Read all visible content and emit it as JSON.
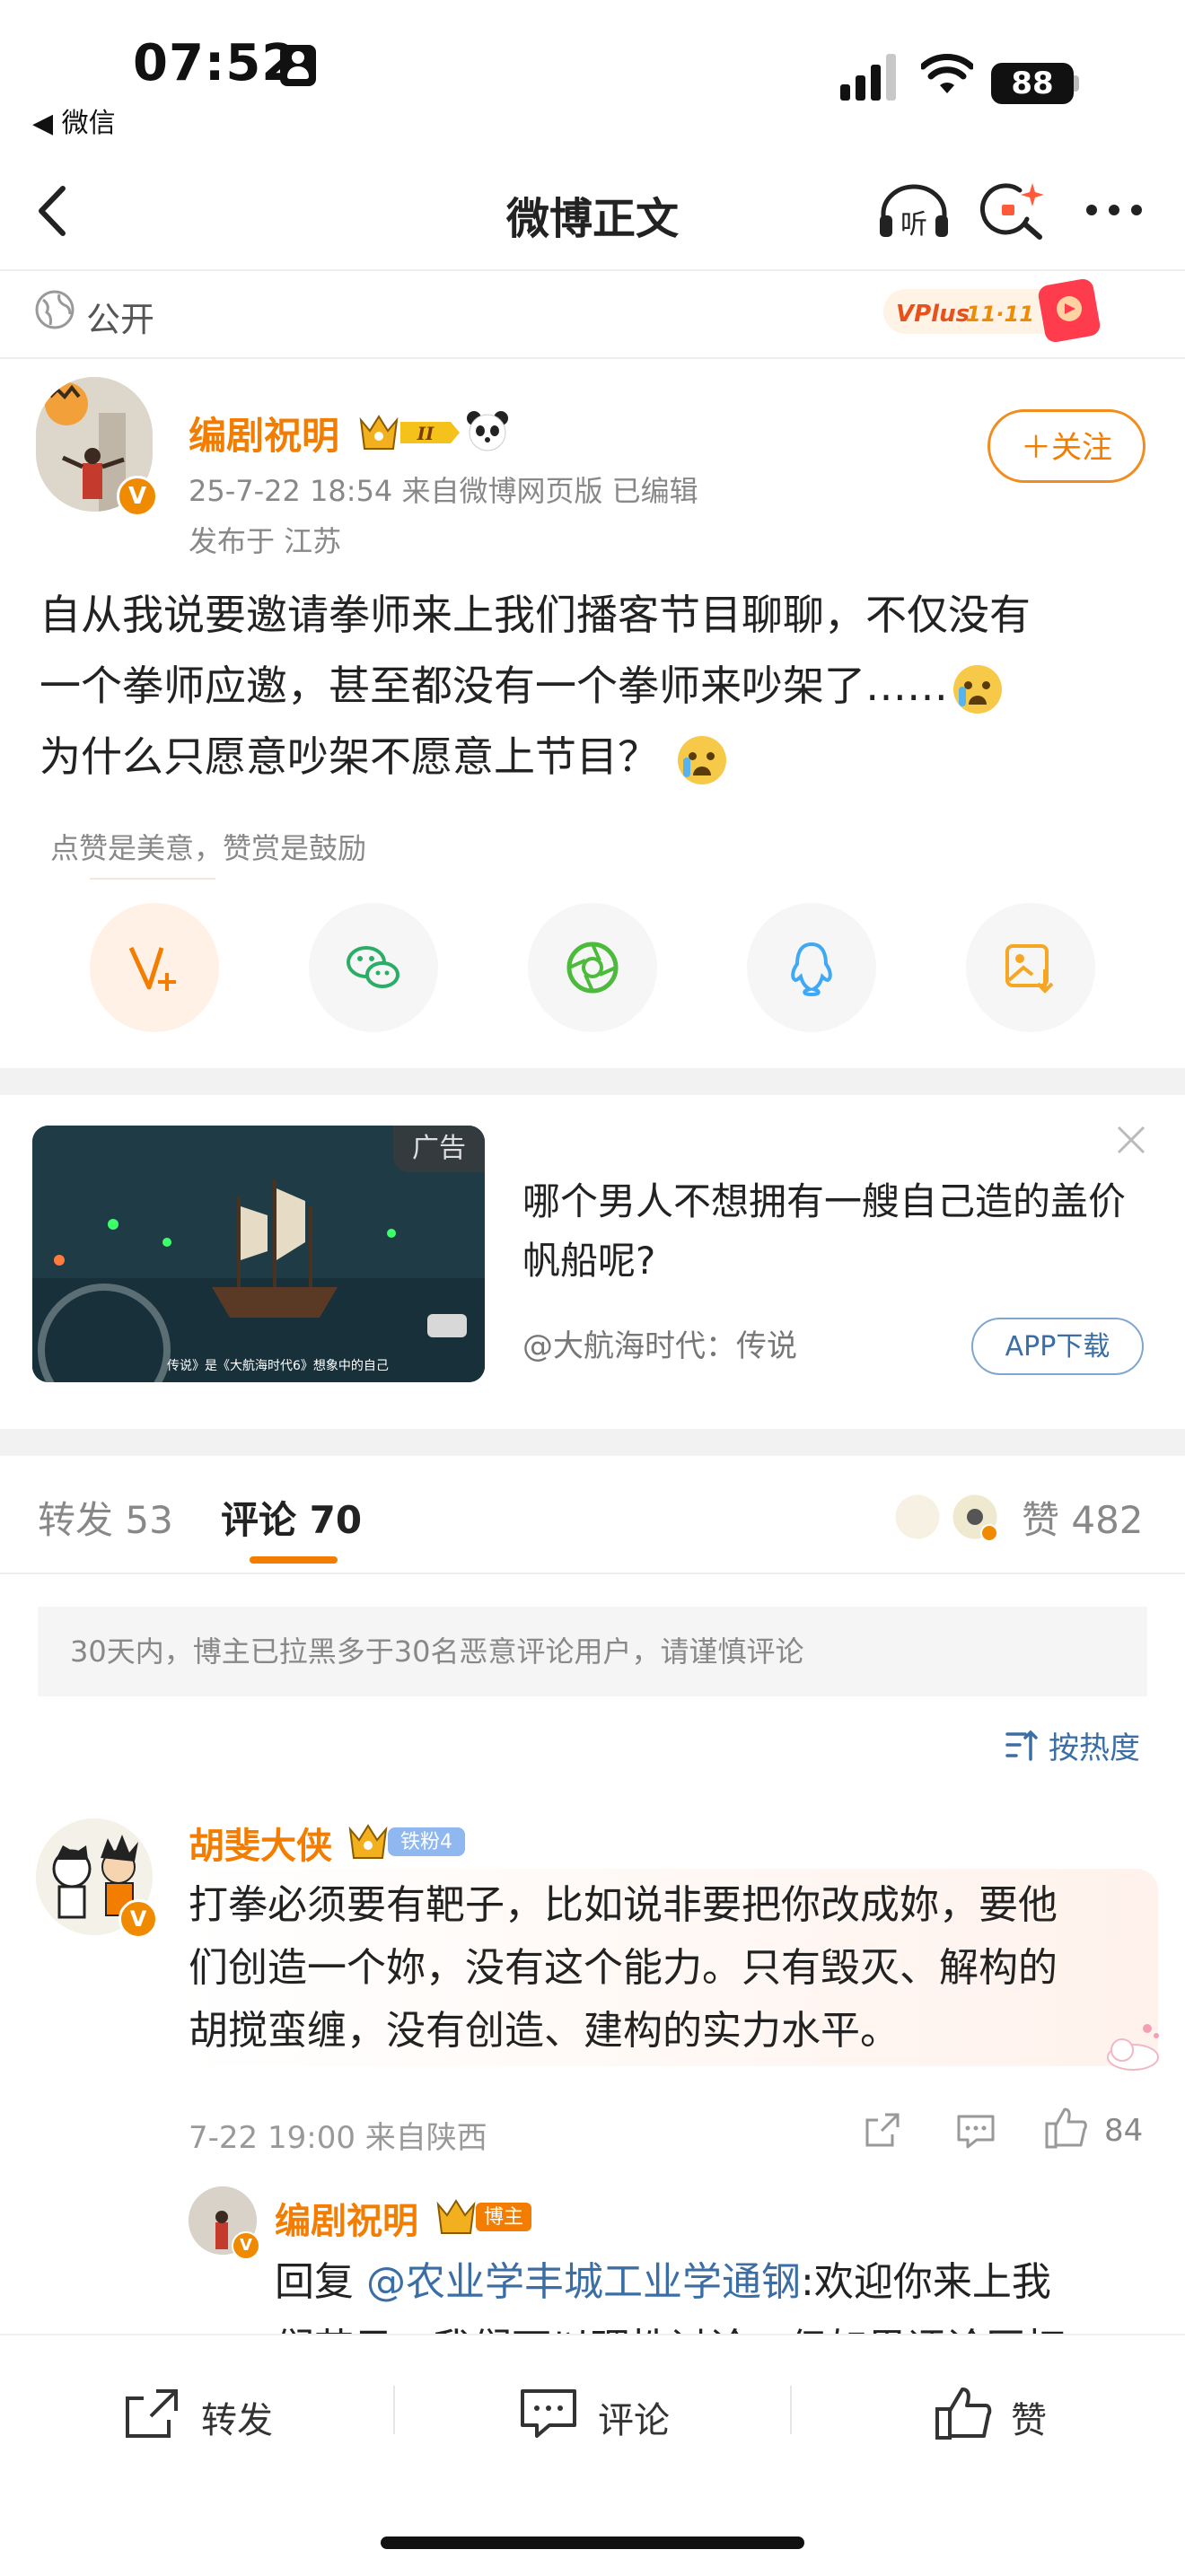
{
  "status_bar": {
    "time": "07:52",
    "back_app": "◀ 微信",
    "battery": "88"
  },
  "nav": {
    "title": "微博正文",
    "listen_label": "听"
  },
  "visibility": {
    "label": "公开",
    "promo_badge": "VPlus 11·11"
  },
  "author": {
    "name": "编剧祝明",
    "level_badge": "II",
    "meta": "25-7-22 18:54  来自微博网页版  已编辑",
    "location": "发布于 江苏",
    "follow_label": "＋关注"
  },
  "post": {
    "line1": "自从我说要邀请拳师来上我们播客节目聊聊，不仅没有",
    "line2": "一个拳师应邀，甚至都没有一个拳师来吵架了……",
    "line3": "为什么只愿意吵架不愿意上节目？"
  },
  "reward": {
    "label": "点赞是美意，赞赏是鼓励"
  },
  "ad": {
    "tag": "广告",
    "title": "哪个男人不想拥有一艘自己造的盖价帆船呢?",
    "source": "@大航海时代：传说",
    "download_label": "APP下载",
    "image_caption": "传说》是《大航海时代6》想象中的自己"
  },
  "tabs": {
    "repost": "转发 53",
    "comment": "评论 70",
    "likes": "赞 482"
  },
  "notice": "30天内，博主已拉黑多于30名恶意评论用户，请谨慎评论",
  "sort_label": "按热度",
  "comment": {
    "name": "胡斐大侠",
    "fan_badge": "铁粉4",
    "line1": "打拳必须要有靶子，比如说非要把你改成妳，要他",
    "line2": "们创造一个妳，没有这个能力。只有毁灭、解构的",
    "line3": "胡搅蛮缠，没有创造、建构的实力水平。",
    "meta": "7-22 19:00  来自陕西",
    "like_count": "84"
  },
  "reply": {
    "name": "编剧祝明",
    "badge": "博主",
    "prefix": "回复",
    "mention": "@农业学丰城工业学通钢",
    "line1_rest": ":欢迎你来上我",
    "line2": "们节目，我们可以理性讨论。但如果评论区打"
  },
  "bottom_bar": {
    "repost": "转发",
    "comment": "评论",
    "like": "赞"
  },
  "colors": {
    "accent": "#f27d00",
    "link": "#3a6ea5",
    "wechat": "#2aae67",
    "qq": "#3fa9f5",
    "save": "#f5a623"
  }
}
